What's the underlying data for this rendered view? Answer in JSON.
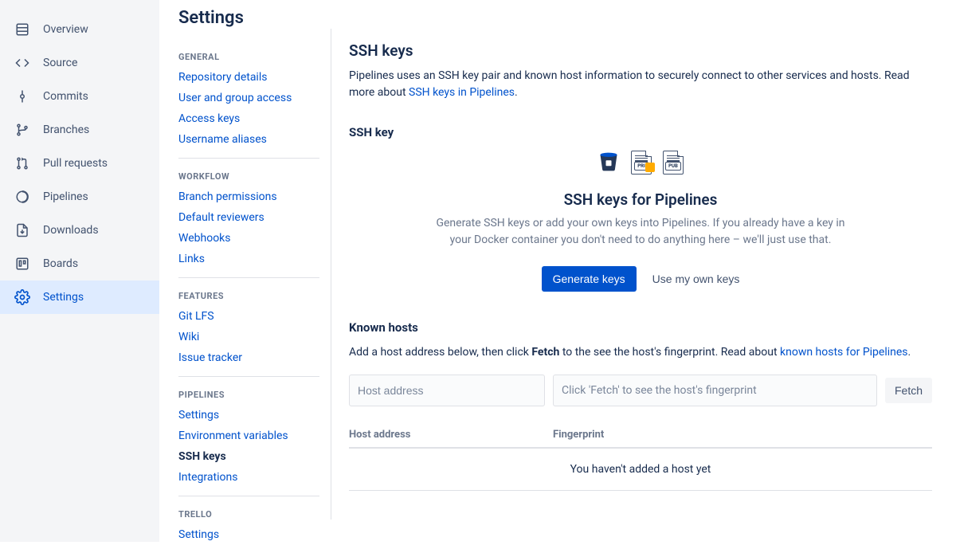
{
  "leftNav": {
    "items": [
      {
        "label": "Overview",
        "icon": "overview-icon"
      },
      {
        "label": "Source",
        "icon": "source-icon"
      },
      {
        "label": "Commits",
        "icon": "commits-icon"
      },
      {
        "label": "Branches",
        "icon": "branches-icon"
      },
      {
        "label": "Pull requests",
        "icon": "pull-requests-icon"
      },
      {
        "label": "Pipelines",
        "icon": "pipelines-icon"
      },
      {
        "label": "Downloads",
        "icon": "downloads-icon"
      },
      {
        "label": "Boards",
        "icon": "boards-icon"
      },
      {
        "label": "Settings",
        "icon": "settings-icon",
        "active": true
      }
    ]
  },
  "settings": {
    "title": "Settings",
    "groups": {
      "general": {
        "header": "GENERAL",
        "items": [
          "Repository details",
          "User and group access",
          "Access keys",
          "Username aliases"
        ]
      },
      "workflow": {
        "header": "WORKFLOW",
        "items": [
          "Branch permissions",
          "Default reviewers",
          "Webhooks",
          "Links"
        ]
      },
      "features": {
        "header": "FEATURES",
        "items": [
          "Git LFS",
          "Wiki",
          "Issue tracker"
        ]
      },
      "pipelines": {
        "header": "PIPELINES",
        "items": [
          "Settings",
          "Environment variables",
          "SSH keys",
          "Integrations"
        ],
        "activeIndex": 2
      },
      "trello": {
        "header": "TRELLO",
        "items": [
          "Settings"
        ]
      }
    }
  },
  "main": {
    "heading": "SSH keys",
    "desc_pre": "Pipelines uses an SSH key pair and known host information to securely connect to other services and hosts. Read more about ",
    "desc_link": "SSH keys in Pipelines",
    "desc_post": ".",
    "sshkey": {
      "label": "SSH key",
      "illus_pri": "PRI",
      "illus_pub": "PUB",
      "empty_title": "SSH keys for Pipelines",
      "empty_desc": "Generate SSH keys or add your own keys into Pipelines. If you already have a key in your Docker container you don't need to do anything here – we'll just use that.",
      "btn_generate": "Generate keys",
      "btn_own": "Use my own keys"
    },
    "knownHosts": {
      "heading": "Known hosts",
      "desc_pre": "Add a host address below, then click ",
      "desc_bold": "Fetch",
      "desc_mid": " to the see the host's fingerprint. Read about ",
      "desc_link": "known hosts for Pipelines",
      "desc_post": ".",
      "host_placeholder": "Host address",
      "fingerprint_placeholder": "Click 'Fetch' to see the host's fingerprint",
      "btn_fetch": "Fetch",
      "th_host": "Host address",
      "th_fingerprint": "Fingerprint",
      "empty_row": "You haven't added a host yet"
    }
  }
}
